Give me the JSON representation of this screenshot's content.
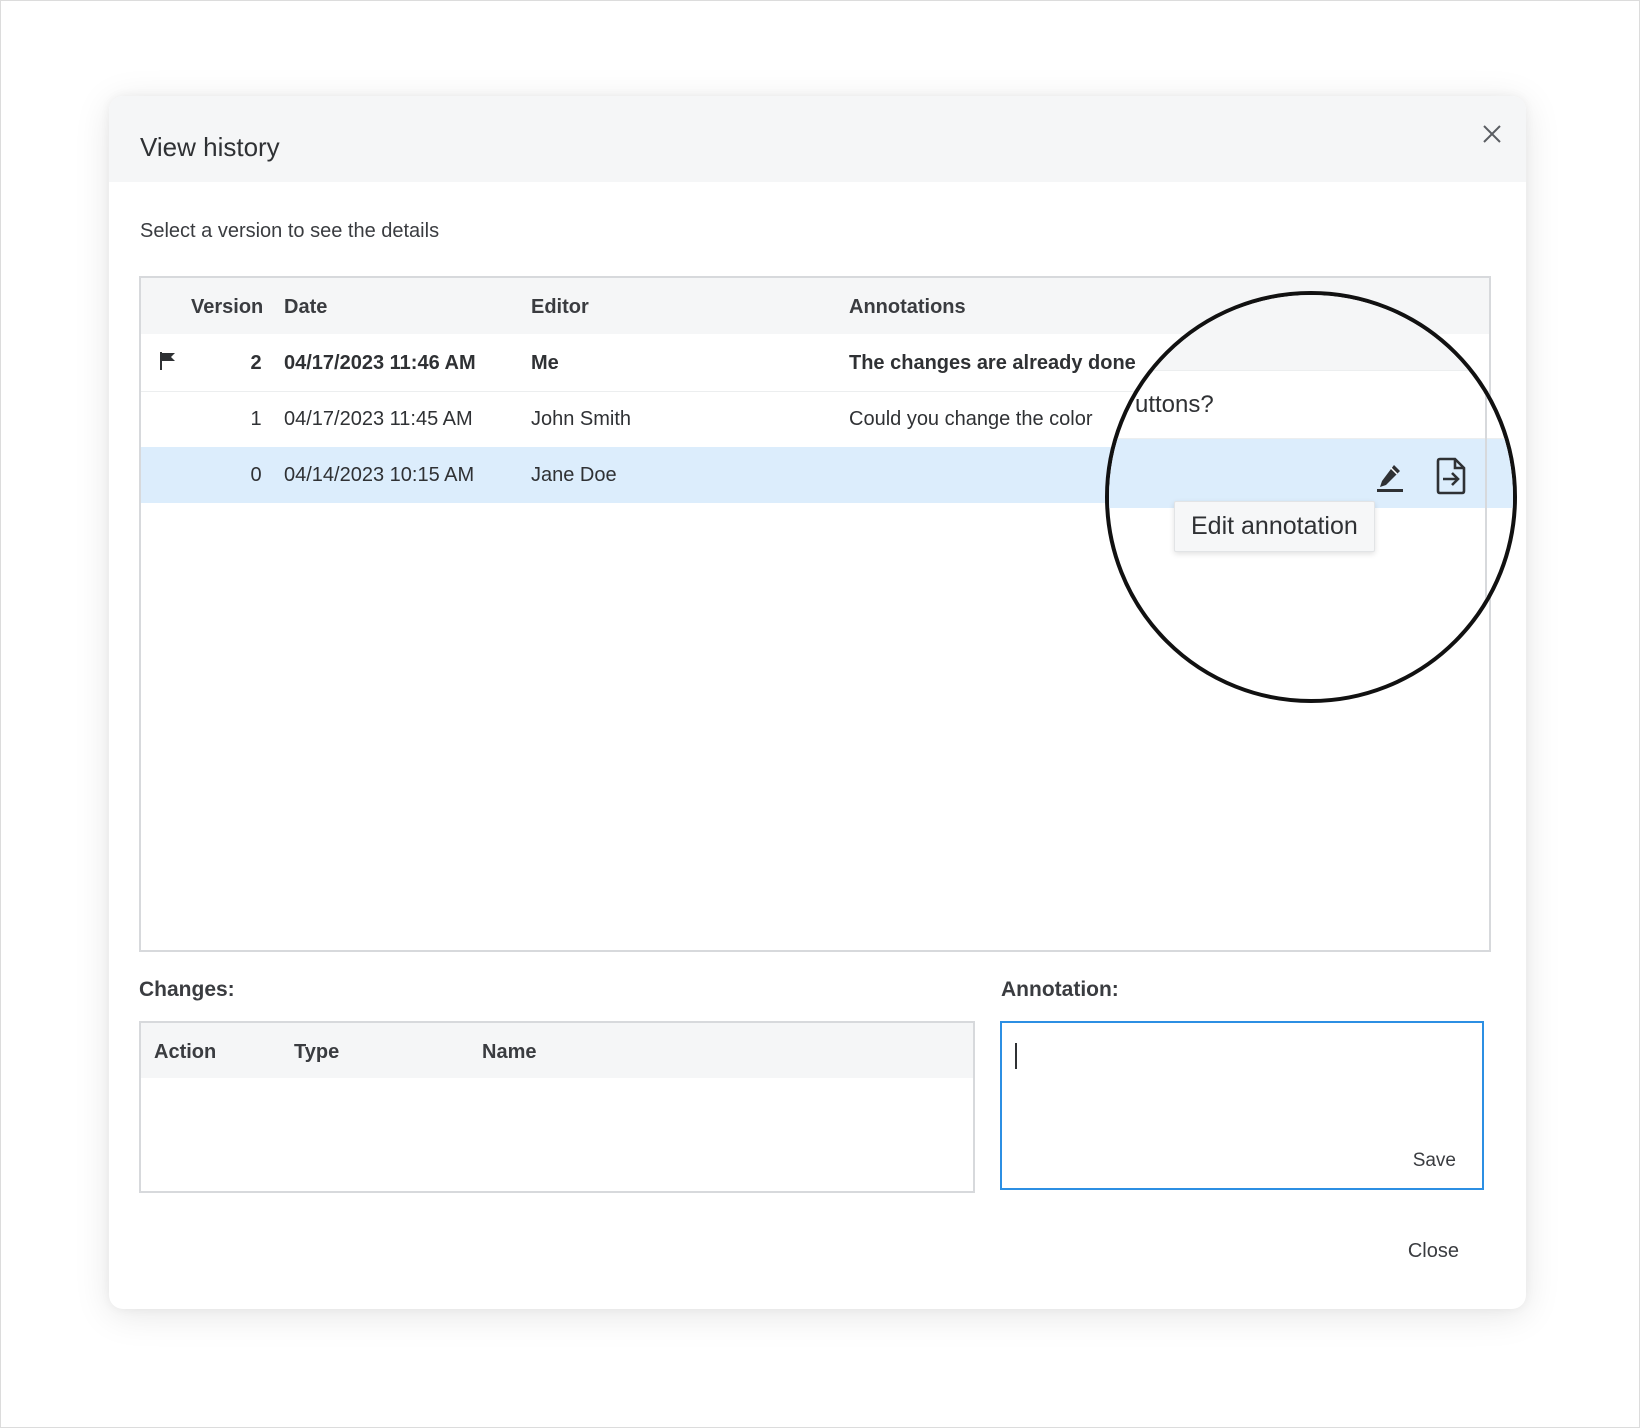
{
  "dialog": {
    "title": "View history",
    "subtitle": "Select a version to see the details",
    "close_label": "Close"
  },
  "history": {
    "columns": {
      "version": "Version",
      "date": "Date",
      "editor": "Editor",
      "annotations": "Annotations"
    },
    "rows": [
      {
        "version": "2",
        "date": "04/17/2023 11:46 AM",
        "editor": "Me",
        "annotation": "The changes are already done",
        "flagged": true,
        "current": true
      },
      {
        "version": "1",
        "date": "04/17/2023 11:45 AM",
        "editor": "John Smith",
        "annotation": "Could you change the color",
        "flagged": false,
        "current": false
      },
      {
        "version": "0",
        "date": "04/14/2023 10:15 AM",
        "editor": "Jane Doe",
        "annotation": "",
        "flagged": false,
        "current": false,
        "selected": true
      }
    ]
  },
  "changes": {
    "label": "Changes:",
    "columns": {
      "action": "Action",
      "type": "Type",
      "name": "Name"
    }
  },
  "annotation_panel": {
    "label": "Annotation:",
    "value": "",
    "save_label": "Save"
  },
  "magnifier": {
    "partial_text": "uttons?",
    "tooltip": "Edit annotation",
    "icons": [
      "pencil-icon",
      "restore-version-icon"
    ]
  },
  "colors": {
    "accent": "#2c8fe3",
    "selected_row": "#dcedfc",
    "header_bg": "#f5f6f7"
  }
}
